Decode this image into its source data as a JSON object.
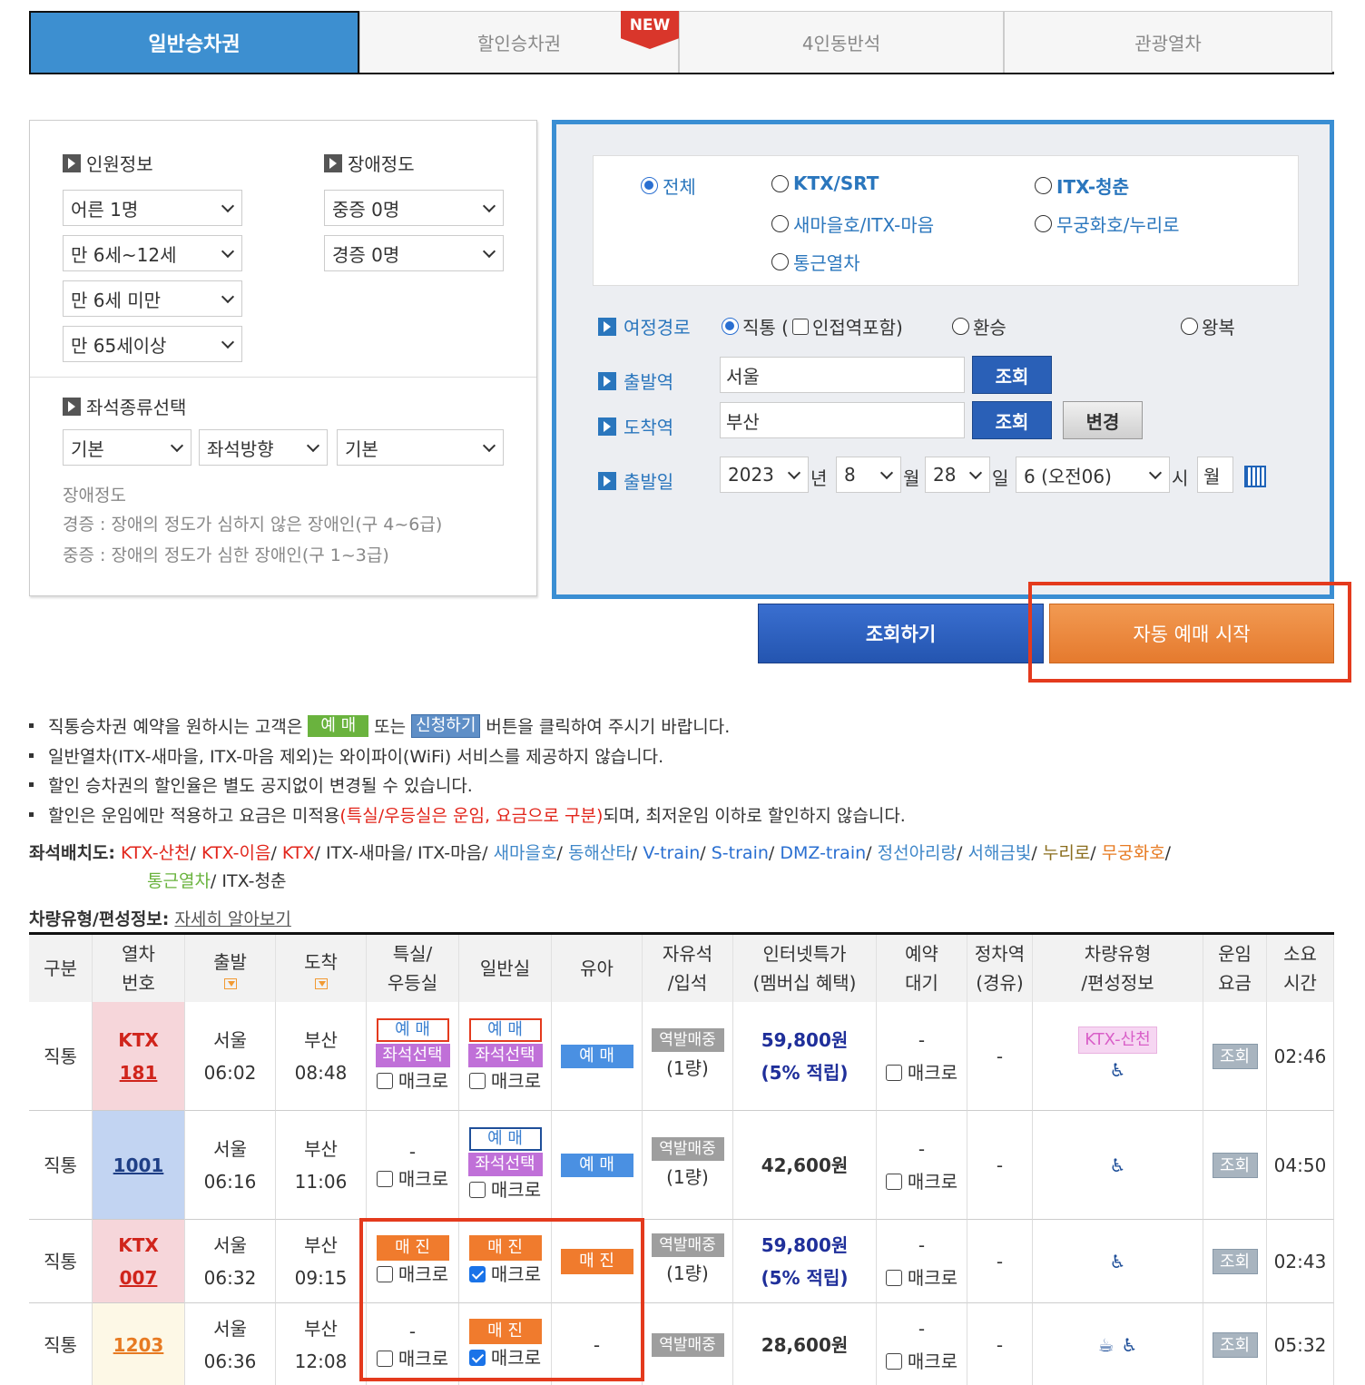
{
  "tabs": [
    {
      "label": "일반승차권"
    },
    {
      "label": "할인승차권"
    },
    {
      "label": "4인동반석"
    },
    {
      "label": "관광열차"
    }
  ],
  "new_badge": "NEW",
  "left": {
    "passenger_title": "인원정보",
    "disability_title": "장애정도",
    "adult": "어른 1명",
    "child": "만 6세~12세",
    "infant": "만 6세 미만",
    "senior": "만 65세이상",
    "severe": "중증 0명",
    "mild": "경증 0명",
    "seat_title": "좌석종류선택",
    "seat1": "기본",
    "seat2": "좌석방향",
    "seat3": "기본",
    "note_title": "장애정도",
    "note_mild": "경증 : 장애의 정도가 심하지 않은 장애인(구 4~6급)",
    "note_severe": "중증 : 장애의 정도가 심한 장애인(구 1~3급)"
  },
  "right": {
    "train_types": [
      "전체",
      "KTX/SRT",
      "ITX-청춘",
      "새마을호/ITX-마음",
      "무궁화호/누리로",
      "통근열차"
    ],
    "route_label": "여정경로",
    "direct": "직통 (",
    "adjacent": "인접역포함)",
    "transfer": "환승",
    "roundtrip": "왕복",
    "dep_label": "출발역",
    "dep_value": "서울",
    "arr_label": "도착역",
    "arr_value": "부산",
    "lookup": "조회",
    "change": "변경",
    "date_label": "출발일",
    "year": "2023",
    "year_u": "년",
    "month": "8",
    "month_u": "월",
    "day": "28",
    "day_u": "일",
    "hour": "6 (오전06)",
    "hour_u": "시",
    "week": "월"
  },
  "actions": {
    "search": "조회하기",
    "auto": "자동 예매 시작"
  },
  "notes": {
    "n1a": "직통승차권 예약을 원하시는 고객은",
    "n1b": "예 매",
    "n1c": "또는",
    "n1d": "신청하기",
    "n1e": "버튼을 클릭하여 주시기 바랍니다.",
    "n2": "일반열차(ITX-새마을, ITX-마음 제외)는 와이파이(WiFi) 서비스를 제공하지 않습니다.",
    "n3": "할인 승차권의 할인율은 별도 공지없이 변경될 수 있습니다.",
    "n4a": "할인은 운임에만 적용하고 요금은 미적용",
    "n4b": "(특실/우등실은 운임, 요금으로 구분)",
    "n4c": "되며, 최저운임 이하로 할인하지 않습니다."
  },
  "seatmap": {
    "label": "좌석배치도:",
    "items": [
      {
        "t": "KTX-산천",
        "c": "#e2251b"
      },
      {
        "t": "KTX-이음",
        "c": "#e2251b"
      },
      {
        "t": "KTX",
        "c": "#e2251b"
      },
      {
        "t": "ITX-새마을",
        "c": "#333333"
      },
      {
        "t": "ITX-마음",
        "c": "#333333"
      },
      {
        "t": "새마을호",
        "c": "#3f87c9"
      },
      {
        "t": "동해산타",
        "c": "#3f87c9"
      },
      {
        "t": "V-train",
        "c": "#2a6fd1"
      },
      {
        "t": "S-train",
        "c": "#2a6fd1"
      },
      {
        "t": "DMZ-train",
        "c": "#2a6fd1"
      },
      {
        "t": "정선아리랑",
        "c": "#3f87c9"
      },
      {
        "t": "서해금빛",
        "c": "#3f87c9"
      },
      {
        "t": "누리로",
        "c": "#8a6d1d"
      },
      {
        "t": "무궁화호",
        "c": "#e77a22"
      }
    ],
    "items2": [
      {
        "t": "통근열차",
        "c": "#6ab33e"
      },
      {
        "t": "ITX-청춘",
        "c": "#333333"
      }
    ]
  },
  "vehicle": {
    "label": "차량유형/편성정보:",
    "link": "자세히 알아보기"
  },
  "table": {
    "headers": [
      [
        "구분"
      ],
      [
        "열차",
        "번호"
      ],
      [
        "출발"
      ],
      [
        "도착"
      ],
      [
        "특실/",
        "우등실"
      ],
      [
        "일반실"
      ],
      [
        "유아"
      ],
      [
        "자유석",
        "/입석"
      ],
      [
        "인터넷특가",
        "(멤버십 혜택)"
      ],
      [
        "예약",
        "대기"
      ],
      [
        "정차역",
        "(경유)"
      ],
      [
        "차량유형",
        "/편성정보"
      ],
      [
        "운임",
        "요금"
      ],
      [
        "소요",
        "시간"
      ]
    ],
    "macro": "매크로",
    "book": "예 매",
    "seat_sel": "좌석선택",
    "soldout": "매 진",
    "standing": "역발매중",
    "dash": "-",
    "lookup": "조회",
    "vehicle_name": "KTX-산천",
    "rows": [
      {
        "type": "직통",
        "tn1": "KTX",
        "tn2": "181",
        "dep": "서울",
        "dept": "06:02",
        "arr": "부산",
        "arrt": "08:48",
        "cars": "(1량)",
        "price": "59,800원",
        "point": "(5% 적립)",
        "time": "02:46"
      },
      {
        "type": "직통",
        "tn1": "",
        "tn2": "1001",
        "dep": "서울",
        "dept": "06:16",
        "arr": "부산",
        "arrt": "11:06",
        "cars": "(1량)",
        "price": "42,600원",
        "point": "",
        "time": "04:50"
      },
      {
        "type": "직통",
        "tn1": "KTX",
        "tn2": "007",
        "dep": "서울",
        "dept": "06:32",
        "arr": "부산",
        "arrt": "09:15",
        "cars": "(1량)",
        "price": "59,800원",
        "point": "(5% 적립)",
        "time": "02:43"
      },
      {
        "type": "직통",
        "tn1": "",
        "tn2": "1203",
        "dep": "서울",
        "dept": "06:36",
        "arr": "부산",
        "arrt": "12:08",
        "cars": "",
        "price": "28,600원",
        "point": "",
        "time": "05:32"
      }
    ]
  }
}
